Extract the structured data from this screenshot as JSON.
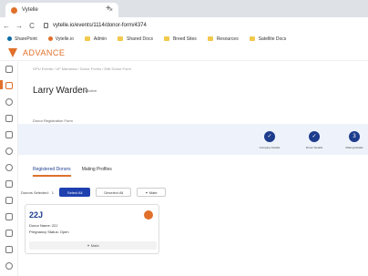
{
  "browser": {
    "tab_title": "Vytelle",
    "url": "vytelle.io/events/1114/donor-form/4374"
  },
  "bookmarks": [
    "SharePoint",
    "Vytelle.io",
    "Admin",
    "Shared Docs",
    "Breed Sites",
    "Resources",
    "Satellite Docs"
  ],
  "app": {
    "brand": "ADVANCE",
    "colors": {
      "accent": "#e0702a",
      "primary": "#1e3c8c"
    }
  },
  "page": {
    "breadcrumb": "OPU Events / UF Marianna / Donor Forms / Edit Donor Form",
    "title": "Larry Warden",
    "status": "• Active",
    "form_label": "Donor Registration Form"
  },
  "steps": [
    {
      "label": "Company Details",
      "mark": "✓"
    },
    {
      "label": "Donor Details",
      "mark": "✓"
    },
    {
      "label": "Mating Details",
      "mark": "3"
    }
  ],
  "tabs": [
    "Registered Donors",
    "Mating Profiles"
  ],
  "selection": {
    "label": "Donors Selected:",
    "count": "1",
    "select_all": "Select All",
    "deselect_all": "Deselect All",
    "mate": "Mate"
  },
  "donor_card": {
    "id": "22J",
    "donor_name": "Donor Name: 22J",
    "pregnancy_status": "Pregnancy Status: Open",
    "mate_button": "Mate"
  }
}
